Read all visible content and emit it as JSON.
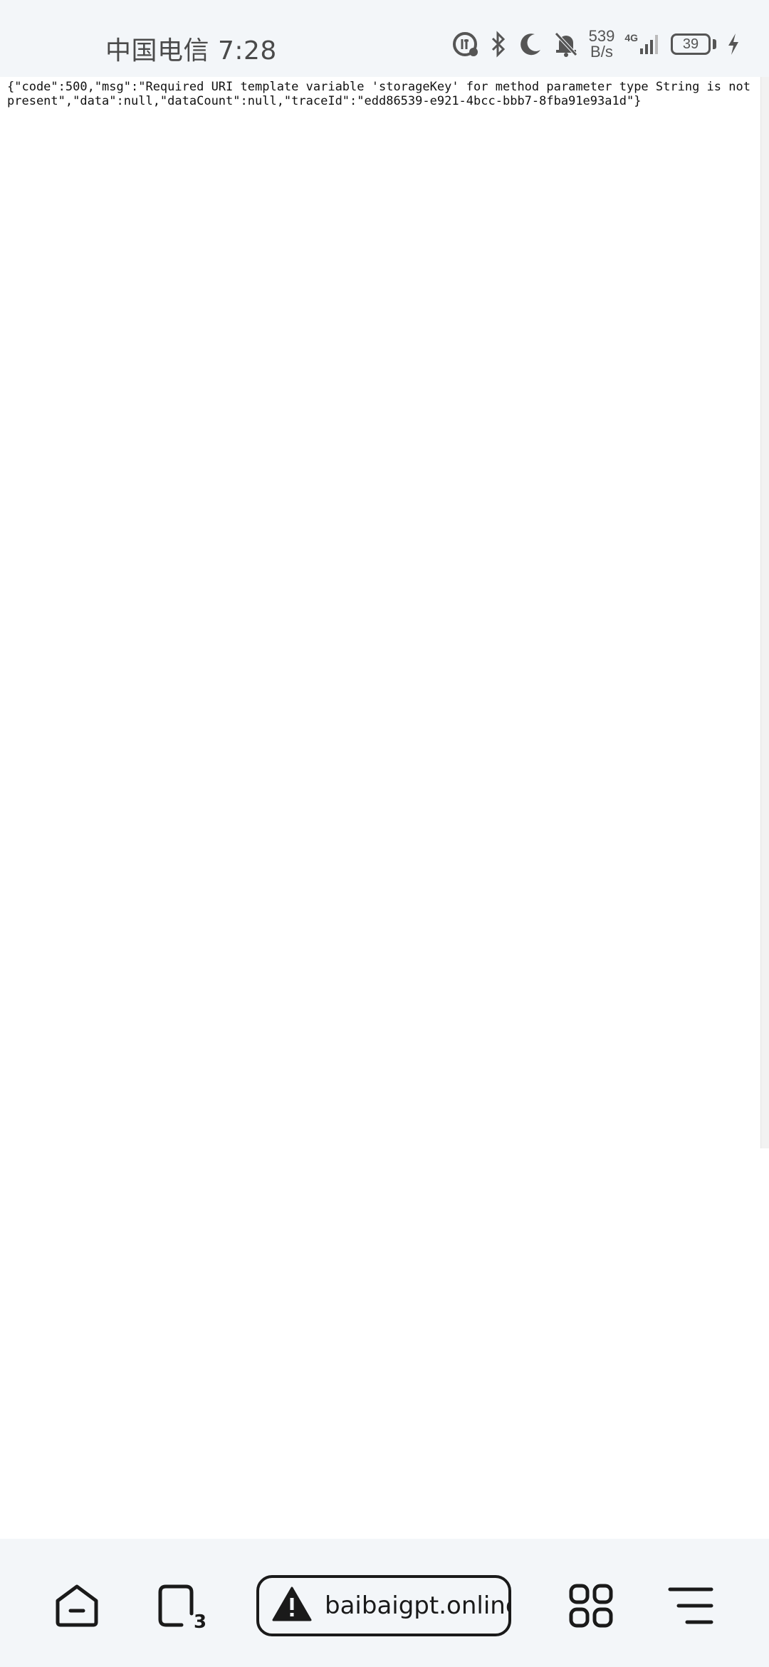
{
  "status_bar": {
    "carrier_time": "中国电信 7:28",
    "net_speed_value": "539",
    "net_speed_unit": "B/s",
    "network_type": "4G",
    "battery_level": "39"
  },
  "page": {
    "body_text": "{\"code\":500,\"msg\":\"Required URI template variable 'storageKey' for method parameter type String is not present\",\"data\":null,\"dataCount\":null,\"traceId\":\"edd86539-e921-4bcc-bbb7-8fba91e93a1d\"}"
  },
  "bottom_bar": {
    "tab_count": "3",
    "url": "baibaigpt.online",
    "icons": {
      "home": "home-icon",
      "tabs": "tabs-icon",
      "security": "warning-icon",
      "apps": "apps-grid-icon",
      "menu": "menu-icon"
    }
  }
}
